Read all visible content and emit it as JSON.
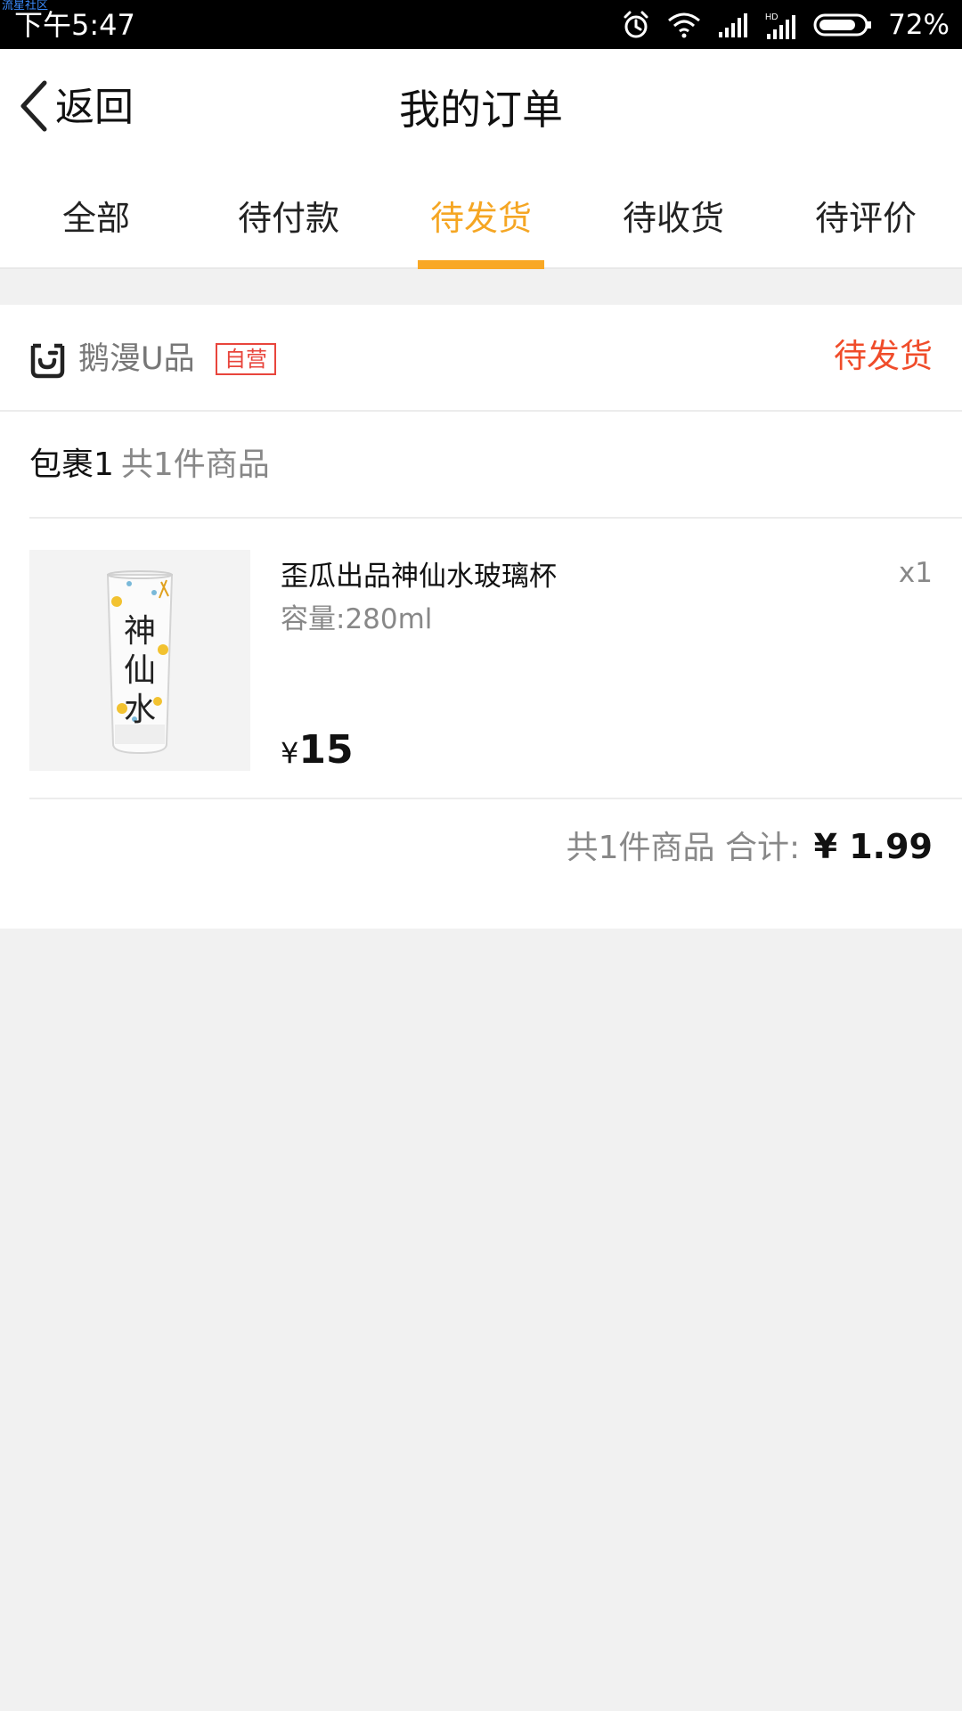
{
  "status_bar": {
    "watermark": "流星社区",
    "time": "下午5:47",
    "battery": "72%"
  },
  "nav": {
    "back_label": "返回",
    "title": "我的订单"
  },
  "tabs": [
    {
      "label": "全部"
    },
    {
      "label": "待付款"
    },
    {
      "label": "待发货",
      "active": true
    },
    {
      "label": "待收货"
    },
    {
      "label": "待评价"
    }
  ],
  "order": {
    "store_name": "鹅漫U品",
    "store_badge": "自营",
    "status": "待发货",
    "package_label": "包裹1",
    "package_count": "共1件商品",
    "product": {
      "name": "歪瓜出品神仙水玻璃杯",
      "spec": "容量:280ml",
      "quantity": "x1",
      "price_symbol": "¥",
      "price": "15",
      "image_text": "神仙水"
    },
    "summary": {
      "count_text": "共1件商品",
      "total_label": "合计:",
      "total_value": "¥ 1.99"
    }
  },
  "colors": {
    "accent": "#f5a623",
    "status_red": "#f04c2a",
    "badge_red": "#e8453c"
  }
}
